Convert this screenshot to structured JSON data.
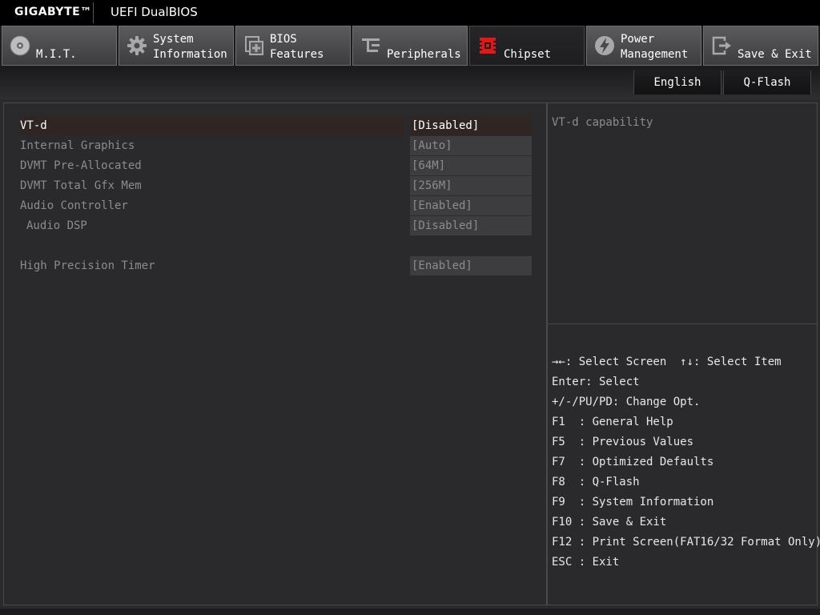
{
  "brand": {
    "logo": "GIGABYTE™",
    "product": "UEFI DualBIOS"
  },
  "tabs": [
    {
      "lines": [
        "",
        "M.I.T."
      ],
      "icon": "disc-icon"
    },
    {
      "lines": [
        "System",
        "Information"
      ],
      "icon": "gear-icon"
    },
    {
      "lines": [
        "BIOS",
        "Features"
      ],
      "icon": "bios-chip-icon"
    },
    {
      "lines": [
        "",
        "Peripherals"
      ],
      "icon": "peripherals-icon"
    },
    {
      "lines": [
        "",
        "Chipset"
      ],
      "icon": "chipset-icon"
    },
    {
      "lines": [
        "Power",
        "Management"
      ],
      "icon": "power-icon"
    },
    {
      "lines": [
        "",
        "Save & Exit"
      ],
      "icon": "exit-icon"
    }
  ],
  "active_tab": "Chipset",
  "toolbar": {
    "language": "English",
    "qflash": "Q-Flash"
  },
  "settings": [
    {
      "label": "VT-d",
      "value": "[Disabled]"
    },
    {
      "label": "Internal Graphics",
      "value": "[Auto]"
    },
    {
      "label": "DVMT Pre-Allocated",
      "value": "[64M]"
    },
    {
      "label": "DVMT Total Gfx Mem",
      "value": "[256M]"
    },
    {
      "label": "Audio Controller",
      "value": "[Enabled]"
    },
    {
      "label": "Audio DSP",
      "value": "[Disabled]"
    },
    {
      "label": "High Precision Timer",
      "value": "[Enabled]"
    }
  ],
  "help": {
    "description": "VT-d capability"
  },
  "keys": [
    "→←: Select Screen  ↑↓: Select Item",
    "Enter: Select",
    "+/-/PU/PD: Change Opt.",
    "F1  : General Help",
    "F5  : Previous Values",
    "F7  : Optimized Defaults",
    "F8  : Q-Flash",
    "F9  : System Information",
    "F10 : Save & Exit",
    "F12 : Print Screen(FAT16/32 Format Only)",
    "ESC : Exit"
  ],
  "colors": {
    "accent_red": "#e01818",
    "selected_row": "#2f2623",
    "inactive_text": "#8c8c8e"
  }
}
